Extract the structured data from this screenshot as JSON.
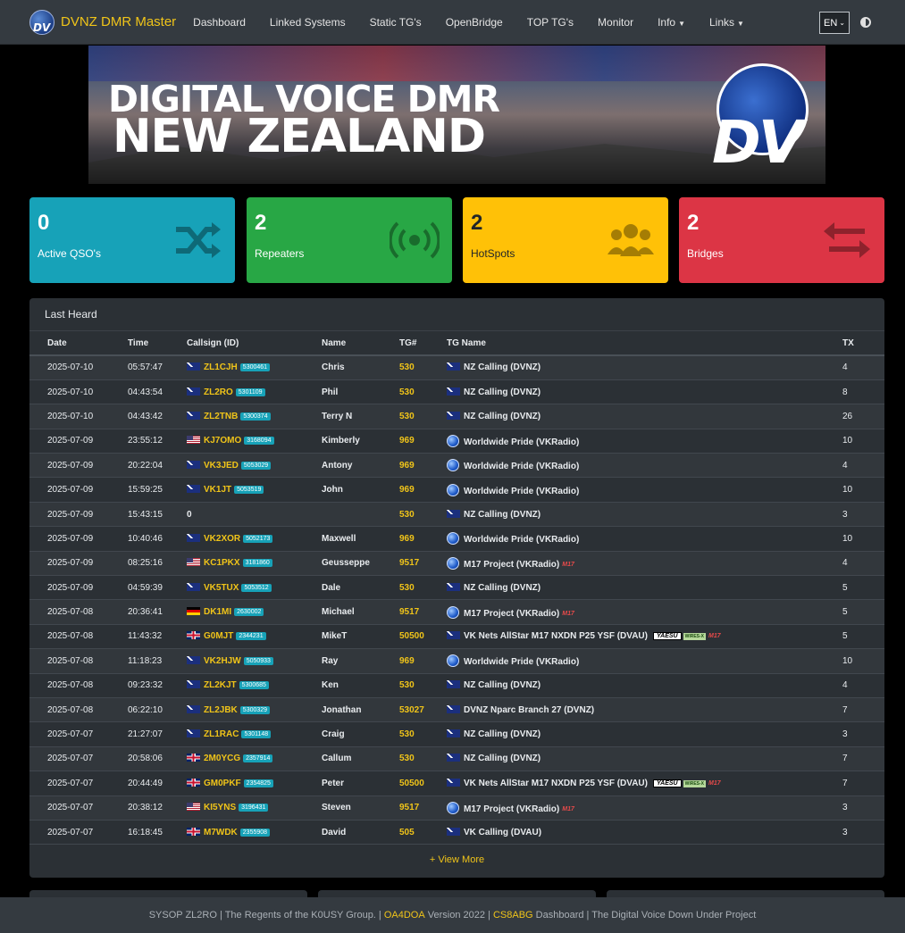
{
  "nav": {
    "brand": "DVNZ DMR Master",
    "links": [
      "Dashboard",
      "Linked Systems",
      "Static TG's",
      "OpenBridge",
      "TOP TG's",
      "Monitor"
    ],
    "info_label": "Info",
    "links_label": "Links",
    "language": "EN"
  },
  "banner": {
    "line1": "DIGITAL VOICE DMR",
    "line2": "NEW ZEALAND",
    "logo_text": "DV"
  },
  "stats": {
    "qso": {
      "value": "0",
      "label": "Active QSO's"
    },
    "repeaters": {
      "value": "2",
      "label": "Repeaters"
    },
    "hotspots": {
      "value": "2",
      "label": "HotSpots"
    },
    "bridges": {
      "value": "2",
      "label": "Bridges"
    }
  },
  "colors": {
    "qso": "#17a2b8",
    "repeaters": "#28a745",
    "hotspots": "#ffc107",
    "bridges": "#dc3545",
    "accent": "#f0c419"
  },
  "last_heard": {
    "title": "Last Heard",
    "columns": [
      "Date",
      "Time",
      "Callsign (ID)",
      "Name",
      "TG#",
      "TG Name",
      "TX"
    ],
    "rows": [
      {
        "date": "2025-07-10",
        "time": "05:57:47",
        "flag": "nz",
        "call": "ZL1CJH",
        "id": "5300461",
        "name": "Chris",
        "tg": "530",
        "tgicon": "flag-au",
        "tgname": "NZ Calling (DVNZ)",
        "tags": [],
        "tx": "4"
      },
      {
        "date": "2025-07-10",
        "time": "04:43:54",
        "flag": "nz",
        "call": "ZL2RO",
        "id": "5301109",
        "name": "Phil",
        "tg": "530",
        "tgicon": "flag-au",
        "tgname": "NZ Calling (DVNZ)",
        "tags": [],
        "tx": "8"
      },
      {
        "date": "2025-07-10",
        "time": "04:43:42",
        "flag": "nz",
        "call": "ZL2TNB",
        "id": "5300374",
        "name": "Terry N",
        "tg": "530",
        "tgicon": "flag-au",
        "tgname": "NZ Calling (DVNZ)",
        "tags": [],
        "tx": "26"
      },
      {
        "date": "2025-07-09",
        "time": "23:55:12",
        "flag": "us",
        "call": "KJ7OMO",
        "id": "3168094",
        "name": "Kimberly",
        "tg": "969",
        "tgicon": "globe",
        "tgname": "Worldwide Pride (VKRadio)",
        "tags": [],
        "tx": "10"
      },
      {
        "date": "2025-07-09",
        "time": "20:22:04",
        "flag": "au",
        "call": "VK3JED",
        "id": "5053029",
        "name": "Antony",
        "tg": "969",
        "tgicon": "globe",
        "tgname": "Worldwide Pride (VKRadio)",
        "tags": [],
        "tx": "4"
      },
      {
        "date": "2025-07-09",
        "time": "15:59:25",
        "flag": "au",
        "call": "VK1JT",
        "id": "5053519",
        "name": "John",
        "tg": "969",
        "tgicon": "globe",
        "tgname": "Worldwide Pride (VKRadio)",
        "tags": [],
        "tx": "10"
      },
      {
        "date": "2025-07-09",
        "time": "15:43:15",
        "flag": "",
        "call": "0",
        "id": "",
        "name": "",
        "tg": "530",
        "tgicon": "flag-au",
        "tgname": "NZ Calling (DVNZ)",
        "tags": [],
        "tx": "3"
      },
      {
        "date": "2025-07-09",
        "time": "10:40:46",
        "flag": "au",
        "call": "VK2XOR",
        "id": "5052173",
        "name": "Maxwell",
        "tg": "969",
        "tgicon": "globe",
        "tgname": "Worldwide Pride (VKRadio)",
        "tags": [],
        "tx": "10"
      },
      {
        "date": "2025-07-09",
        "time": "08:25:16",
        "flag": "us",
        "call": "KC1PKX",
        "id": "3181860",
        "name": "Geusseppe",
        "tg": "9517",
        "tgicon": "globe",
        "tgname": "M17 Project (VKRadio)",
        "tags": [
          "m17"
        ],
        "tx": "4"
      },
      {
        "date": "2025-07-09",
        "time": "04:59:39",
        "flag": "au",
        "call": "VK5TUX",
        "id": "5053512",
        "name": "Dale",
        "tg": "530",
        "tgicon": "flag-au",
        "tgname": "NZ Calling (DVNZ)",
        "tags": [],
        "tx": "5"
      },
      {
        "date": "2025-07-08",
        "time": "20:36:41",
        "flag": "de",
        "call": "DK1MI",
        "id": "2630002",
        "name": "Michael",
        "tg": "9517",
        "tgicon": "globe",
        "tgname": "M17 Project (VKRadio)",
        "tags": [
          "m17"
        ],
        "tx": "5"
      },
      {
        "date": "2025-07-08",
        "time": "11:43:32",
        "flag": "gb",
        "call": "G0MJT",
        "id": "2344231",
        "name": "MikeT",
        "tg": "50500",
        "tgicon": "flag-au",
        "tgname": "VK Nets AllStar M17 NXDN P25 YSF (DVAU)",
        "tags": [
          "yaesu",
          "wires",
          "m17"
        ],
        "tx": "5"
      },
      {
        "date": "2025-07-08",
        "time": "11:18:23",
        "flag": "au",
        "call": "VK2HJW",
        "id": "5050933",
        "name": "Ray",
        "tg": "969",
        "tgicon": "globe",
        "tgname": "Worldwide Pride (VKRadio)",
        "tags": [],
        "tx": "10"
      },
      {
        "date": "2025-07-08",
        "time": "09:23:32",
        "flag": "nz",
        "call": "ZL2KJT",
        "id": "5300685",
        "name": "Ken",
        "tg": "530",
        "tgicon": "flag-au",
        "tgname": "NZ Calling (DVNZ)",
        "tags": [],
        "tx": "4"
      },
      {
        "date": "2025-07-08",
        "time": "06:22:10",
        "flag": "nz",
        "call": "ZL2JBK",
        "id": "5300329",
        "name": "Jonathan",
        "tg": "53027",
        "tgicon": "flag-au",
        "tgname": "DVNZ Nparc Branch 27 (DVNZ)",
        "tags": [],
        "tx": "7"
      },
      {
        "date": "2025-07-07",
        "time": "21:27:07",
        "flag": "nz",
        "call": "ZL1RAC",
        "id": "5301148",
        "name": "Craig",
        "tg": "530",
        "tgicon": "flag-au",
        "tgname": "NZ Calling (DVNZ)",
        "tags": [],
        "tx": "3"
      },
      {
        "date": "2025-07-07",
        "time": "20:58:06",
        "flag": "gb",
        "call": "2M0YCG",
        "id": "2357914",
        "name": "Callum",
        "tg": "530",
        "tgicon": "flag-au",
        "tgname": "NZ Calling (DVNZ)",
        "tags": [],
        "tx": "7"
      },
      {
        "date": "2025-07-07",
        "time": "20:44:49",
        "flag": "gb",
        "call": "GM0PKF",
        "id": "2354825",
        "name": "Peter",
        "tg": "50500",
        "tgicon": "flag-au",
        "tgname": "VK Nets AllStar M17 NXDN P25 YSF (DVAU)",
        "tags": [
          "yaesu",
          "wires",
          "m17"
        ],
        "tx": "7"
      },
      {
        "date": "2025-07-07",
        "time": "20:38:12",
        "flag": "us",
        "call": "KI5YNS",
        "id": "3196431",
        "name": "Steven",
        "tg": "9517",
        "tgicon": "globe",
        "tgname": "M17 Project (VKRadio)",
        "tags": [
          "m17"
        ],
        "tx": "3"
      },
      {
        "date": "2025-07-07",
        "time": "16:18:45",
        "flag": "gb",
        "call": "M7WDK",
        "id": "2355908",
        "name": "David",
        "tg": "505",
        "tgicon": "flag-au",
        "tgname": "VK Calling (DVAU)",
        "tags": [],
        "tx": "3"
      }
    ],
    "view_more": "+ View More"
  },
  "tags": {
    "yaesu": "YAESU",
    "wires": "WIRES-X",
    "m17": "M17"
  },
  "footer": {
    "part1": "SYSOP ZL2RO | The Regents of the K0USY Group. |",
    "link1": "OA4DOA",
    "part2": "Version 2022 |",
    "link2": "CS8ABG",
    "part3": "Dashboard | The Digital Voice Down Under Project"
  }
}
